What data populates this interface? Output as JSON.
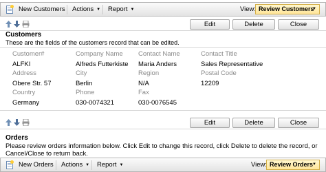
{
  "top_toolbar": {
    "new_label": "New Customers",
    "actions_label": "Actions",
    "report_label": "Report",
    "view_label": "View:",
    "view_value": "Review Customers"
  },
  "customer_form": {
    "buttons": {
      "edit": "Edit",
      "delete": "Delete",
      "close": "Close"
    },
    "title": "Customers",
    "description": "These are the fields of the customers record that can be edited.",
    "fields": {
      "customer_id": {
        "label": "Customer#",
        "value": "ALFKI"
      },
      "company_name": {
        "label": "Company Name",
        "value": "Alfreds Futterkiste"
      },
      "contact_name": {
        "label": "Contact Name",
        "value": "Maria Anders"
      },
      "contact_title": {
        "label": "Contact Title",
        "value": "Sales Representative"
      },
      "address": {
        "label": "Address",
        "value": "Obere Str. 57"
      },
      "city": {
        "label": "City",
        "value": "Berlin"
      },
      "region": {
        "label": "Region",
        "value": "N/A"
      },
      "postal_code": {
        "label": "Postal Code",
        "value": "12209"
      },
      "country": {
        "label": "Country",
        "value": "Germany"
      },
      "phone": {
        "label": "Phone",
        "value": "030-0074321"
      },
      "fax": {
        "label": "Fax",
        "value": "030-0076545"
      }
    }
  },
  "orders": {
    "title": "Orders",
    "description": "Please review orders information below. Click Edit to change this record, click Delete to delete the record, or Cancel/Close to return back."
  },
  "bottom_toolbar": {
    "new_label": "New Orders",
    "actions_label": "Actions",
    "report_label": "Report",
    "view_label": "View:",
    "view_value": "Review Orders"
  },
  "colors": {
    "view_select_bg": "#ffe69a",
    "label_gray": "#8a8a8a"
  }
}
